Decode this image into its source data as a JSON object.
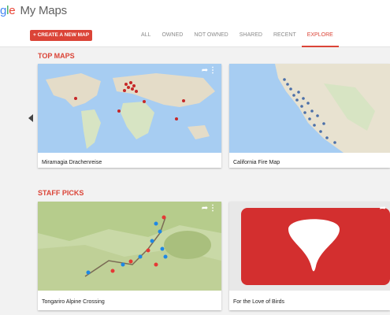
{
  "header": {
    "logo_fragment": "gle",
    "app_name": "My Maps"
  },
  "toolbar": {
    "create_label": "+ CREATE A NEW MAP",
    "tabs": [
      {
        "label": "ALL",
        "active": false
      },
      {
        "label": "OWNED",
        "active": false
      },
      {
        "label": "NOT OWNED",
        "active": false
      },
      {
        "label": "SHARED",
        "active": false
      },
      {
        "label": "RECENT",
        "active": false
      },
      {
        "label": "EXPLORE",
        "active": true
      }
    ]
  },
  "sections": {
    "top_maps": {
      "title": "TOP MAPS",
      "cards": [
        {
          "title": "Miramagia Drachenreise"
        },
        {
          "title": "California Fire Map"
        }
      ]
    },
    "staff_picks": {
      "title": "STAFF PICKS",
      "cards": [
        {
          "title": "Tongariro Alpine Crossing"
        },
        {
          "title": "For the Love of Birds"
        }
      ]
    }
  },
  "icons": {
    "share": "share-icon",
    "more": "more-vert-icon",
    "prev": "chevron-left-icon"
  },
  "colors": {
    "accent": "#db4437",
    "background": "#f2f2f2",
    "card": "#ffffff"
  }
}
